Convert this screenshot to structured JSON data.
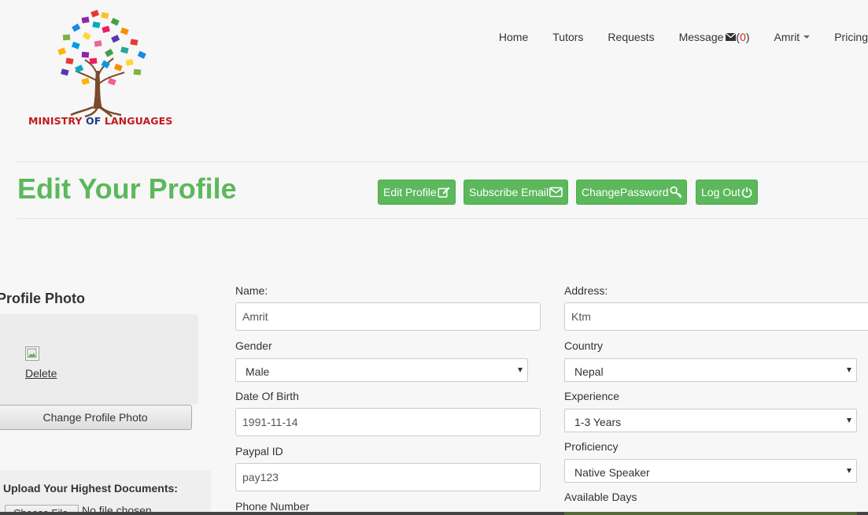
{
  "brand": {
    "logo_text_part1": "MINISTRY",
    "logo_text_part2": "OF",
    "logo_text_part3": "LANGUAGES"
  },
  "nav": {
    "home": "Home",
    "tutors": "Tutors",
    "requests": "Requests",
    "message": "Message",
    "message_count_open": "(",
    "message_count": "0",
    "message_count_close": " )",
    "user": "Amrit",
    "pricing": "Pricing"
  },
  "page": {
    "title": "Edit Your Profile"
  },
  "actions": {
    "edit_profile": "Edit Profile",
    "subscribe_email": "Subscribe Email",
    "change_password": "ChangePassword",
    "log_out": "Log Out"
  },
  "profile_photo": {
    "title": "Profile Photo",
    "delete": "Delete",
    "change": "Change Profile Photo"
  },
  "documents": {
    "label": "Upload Your Highest Documents:",
    "choose_file": "Choose File",
    "no_file": "No file chosen"
  },
  "form": {
    "name_label": "Name:",
    "name_value": "Amrit",
    "gender_label": "Gender",
    "gender_value": "Male",
    "dob_label": "Date Of Birth",
    "dob_value": "1991-11-14",
    "paypal_label": "Paypal ID",
    "paypal_value": "pay123",
    "phone_label": "Phone Number",
    "address_label": "Address:",
    "address_value": "Ktm",
    "country_label": "Country",
    "country_value": "Nepal",
    "experience_label": "Experience",
    "experience_value": "1-3 Years",
    "proficiency_label": "Proficiency",
    "proficiency_value": "Native Speaker",
    "days_label": "Available Days"
  },
  "colors": {
    "accent_green": "#5cb85c",
    "logo_red": "#c21a1f",
    "logo_blue": "#1b3a8c",
    "message_count": "#d9261c"
  }
}
